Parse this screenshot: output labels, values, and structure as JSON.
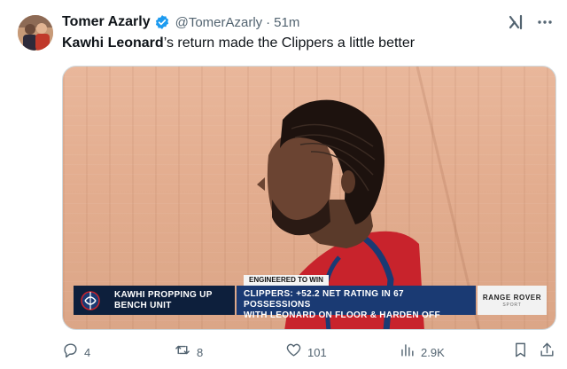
{
  "tweet": {
    "author_name": "Tomer Azarly",
    "handle": "@TomerAzarly",
    "separator": "·",
    "time": "51m",
    "text_bold": "Kawhi Leonard",
    "text_rest": "’s return made the Clippers a little better"
  },
  "media": {
    "tag": "ENGINEERED TO WIN",
    "left_caption_line1": "KAWHI PROPPING UP",
    "left_caption_line2": "BENCH UNIT",
    "mid_caption_line1": "CLIPPERS: +52.2 NET RATING IN 67 POSSESSIONS",
    "mid_caption_line2": "WITH LEONARD ON FLOOR & HARDEN OFF",
    "sponsor_line1": "RANGE ROVER",
    "sponsor_line2": "SPORT"
  },
  "actions": {
    "replies": "4",
    "reposts": "8",
    "likes": "101",
    "views": "2.9K"
  },
  "icons": {
    "verified": "verified-badge-icon",
    "grok": "grok-icon",
    "more": "more-icon",
    "reply": "reply-icon",
    "repost": "repost-icon",
    "like": "heart-icon",
    "views": "views-icon",
    "bookmark": "bookmark-icon",
    "share": "share-icon"
  },
  "colors": {
    "verified_blue": "#1d9bf0",
    "secondary_text": "#536471",
    "ticker_navy": "#0d1f3c",
    "ticker_blue": "#1a3a73"
  }
}
